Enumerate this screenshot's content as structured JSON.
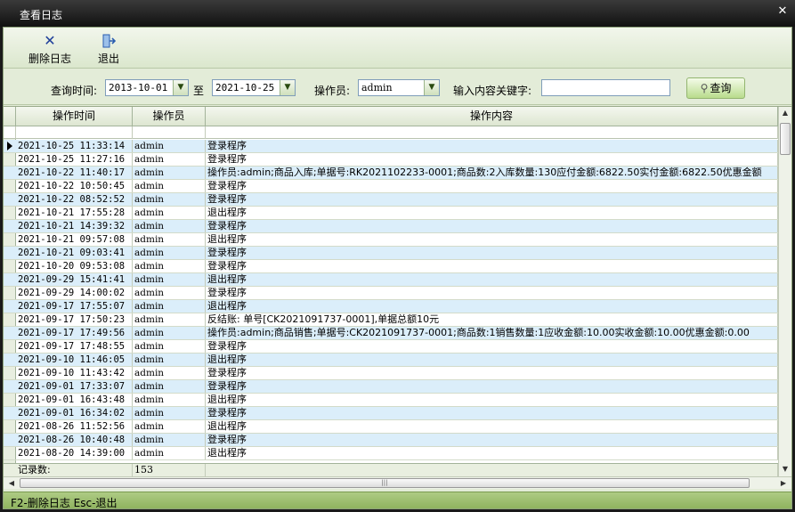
{
  "window": {
    "title": "查看日志",
    "close_icon": "close-icon"
  },
  "toolbar": {
    "delete_label": "删除日志",
    "delete_icon": "cross-icon",
    "exit_label": "退出",
    "exit_icon": "exit-door-icon"
  },
  "filter": {
    "time_label": "查询时间:",
    "start_date": "2013-10-01",
    "to_label": "至",
    "end_date": "2021-10-25",
    "operator_label": "操作员:",
    "operator_value": "admin",
    "keyword_label": "输入内容关键字:",
    "keyword_value": "",
    "query_label": "查询",
    "query_icon": "magnifier-icon"
  },
  "table": {
    "columns": [
      "操作时间",
      "操作员",
      "操作内容"
    ],
    "rows": [
      [
        "2021-10-25 11:33:14",
        "admin",
        "登录程序"
      ],
      [
        "2021-10-25 11:27:16",
        "admin",
        "登录程序"
      ],
      [
        "2021-10-22 11:40:17",
        "admin",
        "操作员:admin;商品入库;单据号:RK2021102233-0001;商品数:2入库数量:130应付金额:6822.50实付金额:6822.50优惠金额"
      ],
      [
        "2021-10-22 10:50:45",
        "admin",
        "登录程序"
      ],
      [
        "2021-10-22 08:52:52",
        "admin",
        "登录程序"
      ],
      [
        "2021-10-21 17:55:28",
        "admin",
        "退出程序"
      ],
      [
        "2021-10-21 14:39:32",
        "admin",
        "登录程序"
      ],
      [
        "2021-10-21 09:57:08",
        "admin",
        "退出程序"
      ],
      [
        "2021-10-21 09:03:41",
        "admin",
        "登录程序"
      ],
      [
        "2021-10-20 09:53:08",
        "admin",
        "登录程序"
      ],
      [
        "2021-09-29 15:41:41",
        "admin",
        "退出程序"
      ],
      [
        "2021-09-29 14:00:02",
        "admin",
        "登录程序"
      ],
      [
        "2021-09-17 17:55:07",
        "admin",
        "退出程序"
      ],
      [
        "2021-09-17 17:50:23",
        "admin",
        "反结账: 单号[CK2021091737-0001],单据总额10元"
      ],
      [
        "2021-09-17 17:49:56",
        "admin",
        "操作员:admin;商品销售;单据号:CK2021091737-0001;商品数:1销售数量:1应收金额:10.00实收金额:10.00优惠金额:0.00"
      ],
      [
        "2021-09-17 17:48:55",
        "admin",
        "登录程序"
      ],
      [
        "2021-09-10 11:46:05",
        "admin",
        "退出程序"
      ],
      [
        "2021-09-10 11:43:42",
        "admin",
        "登录程序"
      ],
      [
        "2021-09-01 17:33:07",
        "admin",
        "登录程序"
      ],
      [
        "2021-09-01 16:43:48",
        "admin",
        "退出程序"
      ],
      [
        "2021-09-01 16:34:02",
        "admin",
        "登录程序"
      ],
      [
        "2021-08-26 11:52:56",
        "admin",
        "退出程序"
      ],
      [
        "2021-08-26 10:40:48",
        "admin",
        "登录程序"
      ],
      [
        "2021-08-20 14:39:00",
        "admin",
        "退出程序"
      ]
    ],
    "footer": {
      "label": "记录数:",
      "count": "153"
    }
  },
  "statusbar": {
    "text": "F2-删除日志 Esc-退出"
  }
}
